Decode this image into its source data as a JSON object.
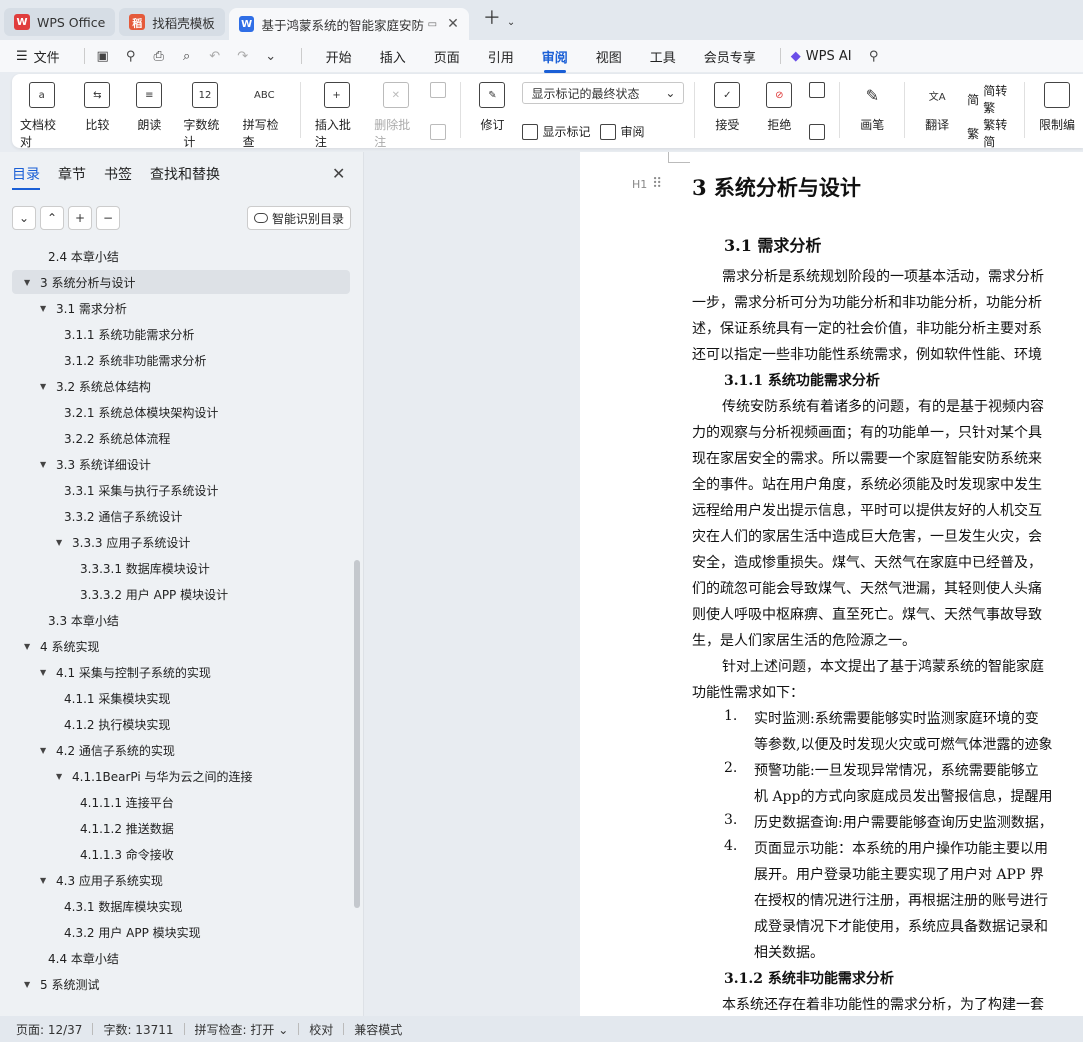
{
  "tabs": [
    {
      "label": "WPS Office",
      "logo": "W",
      "color": "#e03d3d"
    },
    {
      "label": "找稻壳模板",
      "logo": "稻",
      "color": "#e55a3b"
    },
    {
      "label": "基于鸿蒙系统的智能家庭安防",
      "logo": "W",
      "color": "#2f6ee6"
    }
  ],
  "menu": {
    "file": "文件",
    "tabs": [
      "开始",
      "插入",
      "页面",
      "引用",
      "审阅",
      "视图",
      "工具",
      "会员专享"
    ],
    "active_tab": "审阅",
    "ai": "WPS AI"
  },
  "ribbon": {
    "doc_proof": "文档校对",
    "compare": "比较",
    "read": "朗读",
    "word_count": "字数统计",
    "spell_check": "拼写检查",
    "insert_comment": "插入批注",
    "delete_comment": "删除批注",
    "revise": "修订",
    "display_select": "显示标记的最终状态",
    "show_marks": "显示标记",
    "review": "审阅",
    "accept": "接受",
    "reject": "拒绝",
    "pen": "画笔",
    "translate": "翻译",
    "to_traditional": "简转繁",
    "to_simplified": "繁转简",
    "restrict": "限制编"
  },
  "nav": {
    "tabs": [
      "目录",
      "章节",
      "书签",
      "查找和替换"
    ],
    "active": "目录",
    "smart_toc": "智能识别目录",
    "toc": [
      {
        "text": "2.4 本章小结",
        "level": 2,
        "arrow": false
      },
      {
        "text": "3 系统分析与设计",
        "level": 1,
        "arrow": true,
        "selected": true
      },
      {
        "text": "3.1 需求分析",
        "level": 2,
        "arrow": true
      },
      {
        "text": "3.1.1 系统功能需求分析",
        "level": 3,
        "arrow": false
      },
      {
        "text": "3.1.2 系统非功能需求分析",
        "level": 3,
        "arrow": false
      },
      {
        "text": "3.2 系统总体结构",
        "level": 2,
        "arrow": true
      },
      {
        "text": "3.2.1 系统总体模块架构设计",
        "level": 3,
        "arrow": false
      },
      {
        "text": "3.2.2 系统总体流程",
        "level": 3,
        "arrow": false
      },
      {
        "text": "3.3 系统详细设计",
        "level": 2,
        "arrow": true
      },
      {
        "text": "3.3.1 采集与执行子系统设计",
        "level": 3,
        "arrow": false
      },
      {
        "text": "3.3.2 通信子系统设计",
        "level": 3,
        "arrow": false
      },
      {
        "text": "3.3.3 应用子系统设计",
        "level": 3,
        "arrow": true
      },
      {
        "text": "3.3.3.1 数据库模块设计",
        "level": 4,
        "arrow": false
      },
      {
        "text": "3.3.3.2 用户 APP 模块设计",
        "level": 4,
        "arrow": false
      },
      {
        "text": "3.3 本章小结",
        "level": 2,
        "arrow": false
      },
      {
        "text": "4 系统实现",
        "level": 1,
        "arrow": true
      },
      {
        "text": "4.1 采集与控制子系统的实现",
        "level": 2,
        "arrow": true
      },
      {
        "text": "4.1.1 采集模块实现",
        "level": 3,
        "arrow": false
      },
      {
        "text": "4.1.2 执行模块实现",
        "level": 3,
        "arrow": false
      },
      {
        "text": "4.2 通信子系统的实现",
        "level": 2,
        "arrow": true
      },
      {
        "text": "4.1.1BearPi 与华为云之间的连接",
        "level": 3,
        "arrow": true
      },
      {
        "text": "4.1.1.1 连接平台",
        "level": 4,
        "arrow": false
      },
      {
        "text": "4.1.1.2 推送数据",
        "level": 4,
        "arrow": false
      },
      {
        "text": "4.1.1.3 命令接收",
        "level": 4,
        "arrow": false
      },
      {
        "text": "4.3 应用子系统实现",
        "level": 2,
        "arrow": true
      },
      {
        "text": "4.3.1 数据库模块实现",
        "level": 3,
        "arrow": false
      },
      {
        "text": "4.3.2 用户 APP 模块实现",
        "level": 3,
        "arrow": false
      },
      {
        "text": "4.4 本章小结",
        "level": 2,
        "arrow": false
      },
      {
        "text": "5 系统测试",
        "level": 1,
        "arrow": true
      }
    ]
  },
  "document": {
    "h1": "3 系统分析与设计",
    "h1_tag": "H1",
    "h2": "3.1 需求分析",
    "p1": [
      "需求分析是系统规划阶段的一项基本活动，需求分析",
      "一步，需求分析可分为功能分析和非功能分析，功能分析",
      "述，保证系统具有一定的社会价值，非功能分析主要对系",
      "还可以指定一些非功能性系统需求，例如软件性能、环境"
    ],
    "h3a": "3.1.1 系统功能需求分析",
    "p2": [
      "传统安防系统有着诸多的问题，有的是基于视频内容",
      "力的观察与分析视频画面；有的功能单一，只针对某个具",
      "现在家居安全的需求。所以需要一个家庭智能安防系统来",
      "全的事件。站在用户角度，系统必须能及时发现家中发生",
      "远程给用户发出提示信息，平时可以提供友好的人机交互",
      "灾在人们的家居生活中造成巨大危害，一旦发生火灾，会",
      "安全，造成惨重损失。煤气、天然气在家庭中已经普及，",
      "们的疏忽可能会导致煤气、天然气泄漏，其轻则使人头痛",
      "则使人呼吸中枢麻痹、直至死亡。煤气、天然气事故导致",
      "生，是人们家居生活的危险源之一。"
    ],
    "p3": [
      "针对上述问题，本文提出了基于鸿蒙系统的智能家庭",
      "功能性需求如下："
    ],
    "list": [
      {
        "num": "1.",
        "lines": [
          "实时监测:系统需要能够实时监测家庭环境的变",
          "等参数,以便及时发现火灾或可燃气体泄露的迹象"
        ]
      },
      {
        "num": "2.",
        "lines": [
          "预警功能:一旦发现异常情况，系统需要能够立",
          "机 App的方式向家庭成员发出警报信息，提醒用"
        ]
      },
      {
        "num": "3.",
        "lines": [
          "历史数据查询:用户需要能够查询历史监测数据，"
        ]
      },
      {
        "num": "4.",
        "lines": [
          "页面显示功能：本系统的用户操作功能主要以用",
          "展开。用户登录功能主要实现了用户对 APP 界",
          "在授权的情况进行注册，再根据注册的账号进行",
          "成登录情况下才能使用，系统应具备数据记录和",
          "相关数据。"
        ]
      }
    ],
    "h3b": "3.1.2 系统非功能需求分析",
    "p4": "本系统还存在着非功能性的需求分析，为了构建一套"
  },
  "status": {
    "page": "页面: 12/37",
    "words": "字数: 13711",
    "spell": "拼写检查: 打开",
    "proof": "校对",
    "compat": "兼容模式"
  },
  "colors": {
    "accent": "#1a5fd6"
  }
}
